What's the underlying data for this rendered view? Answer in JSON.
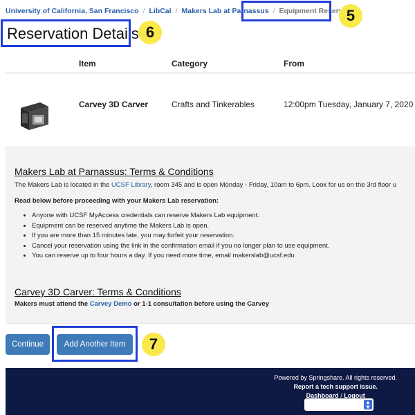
{
  "breadcrumb": {
    "items": [
      "University of California, San Francisco",
      "LibCal",
      "Makers Lab at Parnassus"
    ],
    "current": "Equipment Reservation",
    "separator": "/"
  },
  "page_title": "Reservation Details",
  "callouts": {
    "breadcrumb": "5",
    "title": "6",
    "add_button": "7"
  },
  "table": {
    "headers": {
      "item": "Item",
      "category": "Category",
      "from": "From"
    },
    "rows": [
      {
        "item": "Carvey 3D Carver",
        "category": "Crafts and Tinkerables",
        "from": "12:00pm Tuesday, January 7, 2020"
      }
    ]
  },
  "terms": {
    "lab_title": "Makers Lab at Parnassus: Terms & Conditions",
    "location_pre": "The Makers Lab is located in the",
    "location_link": "UCSF Library",
    "location_post": ", room 345 and is open Monday - Friday, 10am to 6pm. Look for us on the 3rd floor u",
    "read_below": "Read below before proceeding with your Makers Lab reservation:",
    "rules": [
      "Anyone with UCSF MyAccess credentials can reserve Makers Lab equipment.",
      "Equipment can be reserved anytime the Makers Lab is open.",
      "If you are more than 15 minutes late, you may forfeit your reservation.",
      "Cancel your reservation using the link in the confirmation email if you no longer plan to use equipment.",
      "You can reserve up to four hours a day. If you need more time, email makerslab@ucsf.edu"
    ],
    "carvey_title": "Carvey 3D Carver: Terms & Conditions",
    "carvey_pre": "Makers must attend the",
    "carvey_link": "Carvey Demo",
    "carvey_post": "or 1-1 consultation before using the Carvey"
  },
  "buttons": {
    "continue": "Continue",
    "add_another": "Add Another Item"
  },
  "footer": {
    "powered_by": "Powered by Springshare. All rights reserved.",
    "report": "Report a tech support issue.",
    "dashboard": "Dashboard",
    "separator": "/",
    "logout": "Logout"
  },
  "colors": {
    "link": "#2a5fa8",
    "button": "#3f7bb9",
    "footer": "#0f1a44",
    "annotation_box": "#1f3fd6",
    "callout": "#f9e94a"
  }
}
